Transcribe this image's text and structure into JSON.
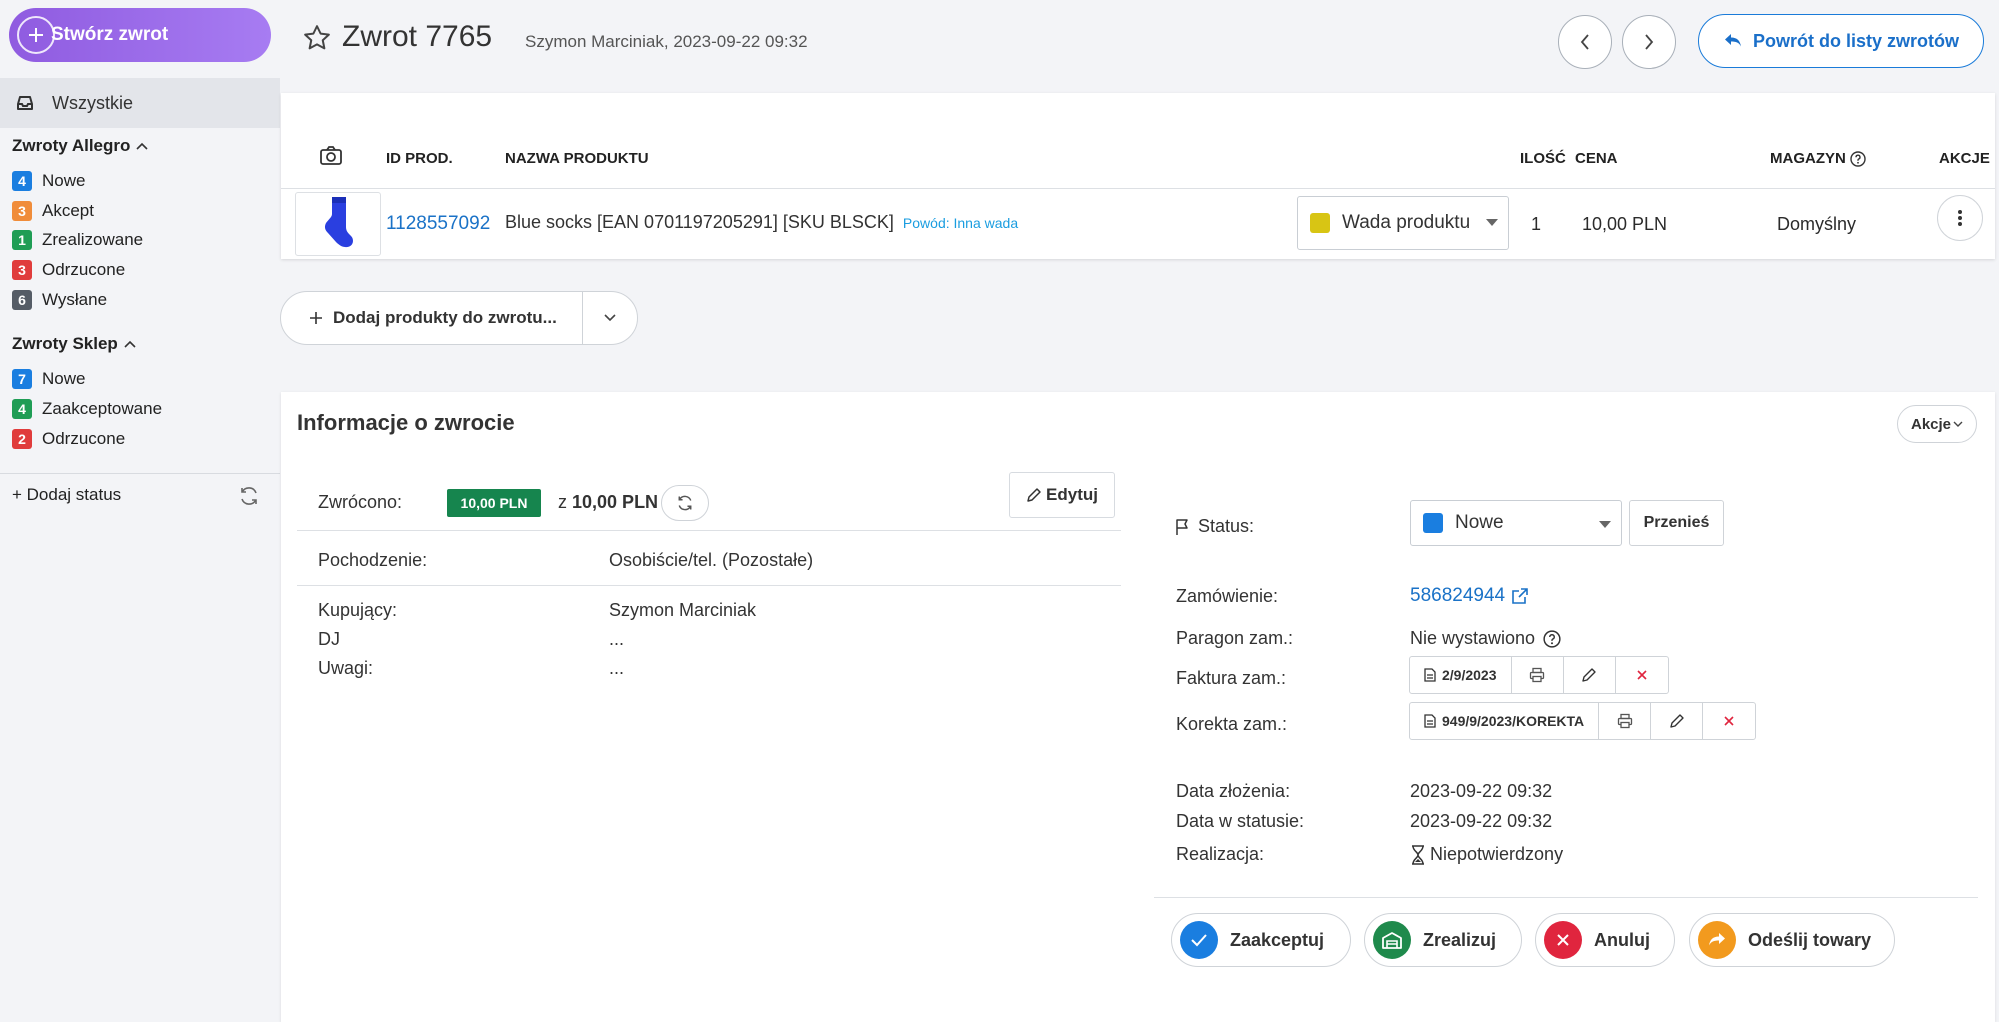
{
  "sidebar": {
    "create_label": "Stwórz zwrot",
    "all_label": "Wszystkie",
    "allegro_header": "Zwroty Allegro",
    "allegro_items": [
      {
        "count": "4",
        "label": "Nowe",
        "color": "#1a7ee0"
      },
      {
        "count": "3",
        "label": "Akcept",
        "color": "#f08c3a"
      },
      {
        "count": "1",
        "label": "Zrealizowane",
        "color": "#1f9d55"
      },
      {
        "count": "3",
        "label": "Odrzucone",
        "color": "#e03c3c"
      },
      {
        "count": "6",
        "label": "Wysłane",
        "color": "#555c66"
      }
    ],
    "shop_header": "Zwroty Sklep",
    "shop_items": [
      {
        "count": "7",
        "label": "Nowe",
        "color": "#1a7ee0"
      },
      {
        "count": "4",
        "label": "Zaakceptowane",
        "color": "#1f9d55"
      },
      {
        "count": "2",
        "label": "Odrzucone",
        "color": "#e03c3c"
      }
    ],
    "add_status": "+ Dodaj status"
  },
  "header": {
    "title": "Zwrot 7765",
    "meta": "Szymon Marciniak, 2023-09-22 09:32",
    "back_label": "Powrót do listy zwrotów"
  },
  "products": {
    "columns": {
      "id": "ID PROD.",
      "name": "NAZWA PRODUKTU",
      "qty": "ILOŚĆ",
      "price": "CENA",
      "warehouse": "MAGAZYN",
      "actions": "AKCJE"
    },
    "rows": [
      {
        "id": "1128557092",
        "name": "Blue socks [EAN 0701197205291] [SKU BLSCK]",
        "reason": "Powód: Inna wada",
        "reason_select": "Wada produktu",
        "qty": "1",
        "price": "10,00 PLN",
        "warehouse": "Domyślny"
      }
    ],
    "add_label": "Dodaj produkty do zwrotu..."
  },
  "info": {
    "title": "Informacje o zwrocie",
    "actions_label": "Akcje",
    "returned_label": "Zwrócono:",
    "returned_amount": "10,00 PLN",
    "returned_of_prefix": "z",
    "returned_of": "10,00 PLN",
    "edit_label": "Edytuj",
    "origin_label": "Pochodzenie:",
    "origin_value": "Osobiście/tel. (Pozostałe)",
    "buyer_label": "Kupujący:",
    "buyer_value": "Szymon Marciniak",
    "dj_label": "DJ",
    "dj_value": "...",
    "notes_label": "Uwagi:",
    "notes_value": "...",
    "status_label": "Status:",
    "status_value": "Nowe",
    "move_label": "Przenieś",
    "order_label": "Zamówienie:",
    "order_value": "586824944",
    "receipt_label": "Paragon zam.:",
    "receipt_value": "Nie wystawiono",
    "invoice_label": "Faktura zam.:",
    "invoice_value": "2/9/2023",
    "correction_label": "Korekta zam.:",
    "correction_value": "949/9/2023/KOREKTA",
    "date_submitted_label": "Data złożenia:",
    "date_submitted": "2023-09-22 09:32",
    "date_status_label": "Data w statusie:",
    "date_status": "2023-09-22 09:32",
    "realization_label": "Realizacja:",
    "realization_value": "Niepotwierdzony"
  },
  "action_buttons": [
    {
      "label": "Zaakceptuj",
      "color": "#1a7ee0",
      "icon": "check-icon"
    },
    {
      "label": "Zrealizuj",
      "color": "#1f8a4c",
      "icon": "warehouse-icon"
    },
    {
      "label": "Anuluj",
      "color": "#e0253e",
      "icon": "close-icon"
    },
    {
      "label": "Odeślij towary",
      "color": "#f29a1e",
      "icon": "share-arrow-icon"
    }
  ]
}
